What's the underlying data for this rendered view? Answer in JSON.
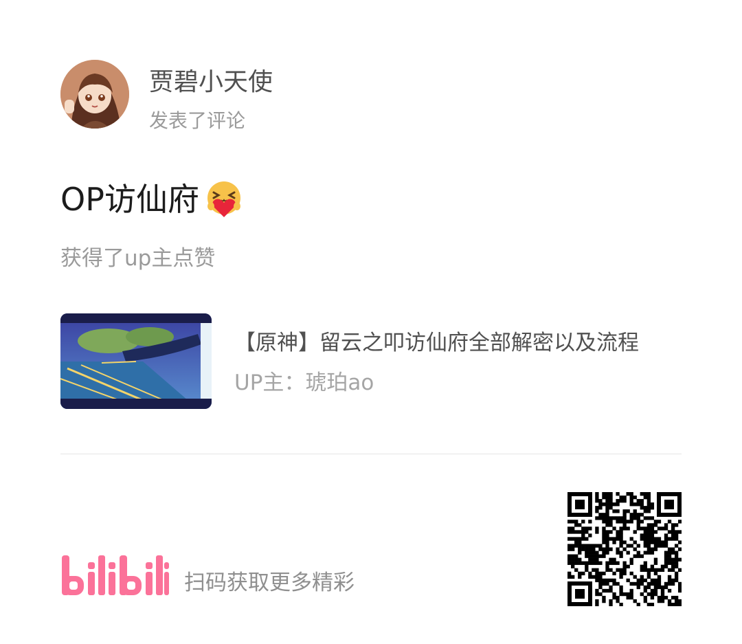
{
  "post": {
    "user_name": "贾碧小天使",
    "action": "发表了评论",
    "comment_text": "OP访仙府",
    "comment_emoji": "hug-heart-emoji",
    "like_note": "获得了up主点赞"
  },
  "video": {
    "title": "【原神】留云之叩访仙府全部解密以及流程",
    "uploader": "UP主：琥珀ao"
  },
  "footer": {
    "logo_text": "bilibili",
    "scan_text": "扫码获取更多精彩"
  },
  "colors": {
    "brand_pink": "#fb7299",
    "text_dark": "#1c1c1c",
    "text_gray": "#9a9a9a"
  }
}
